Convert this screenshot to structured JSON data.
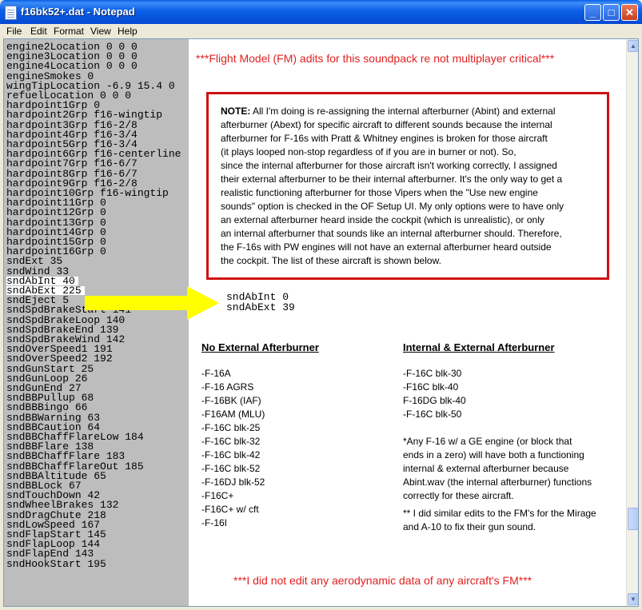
{
  "window": {
    "title": "f16bk52+.dat - Notepad"
  },
  "menu": [
    "File",
    "Edit",
    "Format",
    "View",
    "Help"
  ],
  "colors": {
    "header_red": "#E02020",
    "box_red": "#D01010",
    "arrow_yellow": "#FFFF00",
    "panel_gray": "#BDBDBD"
  },
  "text_lines": [
    "engine2Location 0 0 0",
    "engine3Location 0 0 0",
    "engine4Location 0 0 0",
    "engineSmokes 0",
    "wingTipLocation -6.9 15.4 0",
    "refuelLocation 0 0 0",
    "hardpoint1Grp 0",
    "hardpoint2Grp f16-wingtip",
    "hardpoint3Grp f16-2/8",
    "hardpoint4Grp f16-3/4",
    "hardpoint5Grp f16-3/4",
    "hardpoint6Grp f16-centerline",
    "hardpoint7Grp f16-6/7",
    "hardpoint8Grp f16-6/7",
    "hardpoint9Grp f16-2/8",
    "hardpoint10Grp f16-wingtip",
    "hardpoint11Grp 0",
    "hardpoint12Grp 0",
    "hardpoint13Grp 0",
    "hardpoint14Grp 0",
    "hardpoint15Grp 0",
    "hardpoint16Grp 0",
    "sndExt 35",
    "sndWind 33",
    "sndAbInt 40",
    "sndAbExt 225",
    "sndEject 5",
    "sndSpdBrakeStart 141",
    "sndSpdBrakeLoop 140",
    "sndSpdBrakeEnd 139",
    "sndSpdBrakeWind 142",
    "sndOverSpeed1 191",
    "sndOverSpeed2 192",
    "sndGunStart 25",
    "sndGunLoop 26",
    "sndGunEnd 27",
    "sndBBPullup 68",
    "sndBBBingo 66",
    "sndBBWarning 63",
    "sndBBCaution 64",
    "sndBBChaffFlareLow 184",
    "sndBBFlare 138",
    "sndBBChaffFlare 183",
    "sndBBChaffFlareOut 185",
    "sndBBAltitude 65",
    "sndBBLock 67",
    "sndTouchDown 42",
    "sndWheelBrakes 132",
    "sndDragChute 218",
    "sndLowSpeed 167",
    "sndFlapStart 145",
    "sndFlapLoop 144",
    "sndFlapEnd 143",
    "sndHookStart 195"
  ],
  "header_note": "***Flight Model (FM) adits for this soundpack re not multiplayer  critical***",
  "note": {
    "label": "NOTE:",
    "lines": [
      " All I'm doing is re-assigning the internal afterburner (Abint) and external",
      "afterburner (Abext) for specific aircraft to different sounds because the internal",
      "afterburner for F-16s with Pratt & Whitney engines is broken for those aircraft",
      "(it plays looped non-stop regardless of if you are in burner or not). So,",
      "since the internal afterburner for those aircraft isn't working correctly, I assigned",
      "their external afterburner to be their internal afterburner.  It's the only way to get a",
      "realistic functioning afterburner for those Vipers when the \"Use new engine",
      "sounds\" option is checked in the OF Setup UI.  My only options were to have only",
      "an external afterburner heard inside the cockpit (which is unrealistic), or only",
      "an internal afterburner that sounds like an internal afterburner should.  Therefore,",
      "the F-16s with PW engines will not have an external afterburner heard outside",
      "the cockpit.  The list of these aircraft is shown below."
    ]
  },
  "new_values": [
    "sndAbInt 0",
    "sndAbExt 39"
  ],
  "no_external": {
    "heading": "No External Afterburner",
    "items": [
      "-F-16A",
      "-F-16 AGRS",
      "-F-16BK (IAF)",
      "-F16AM (MLU)",
      "-F-16C blk-25",
      "-F-16C blk-32",
      "-F-16C blk-42",
      "-F-16C blk-52",
      "-F-16DJ blk-52",
      "-F16C+",
      "-F16C+ w/ cft",
      "-F-16I"
    ]
  },
  "int_ext": {
    "heading": "Internal & External Afterburner",
    "items": [
      "-F-16C blk-30",
      "-F16C blk-40",
      "F-16DG blk-40",
      "-F-16C blk-50"
    ]
  },
  "ge_note": [
    "*Any F-16 w/ a GE engine (or block that",
    "ends in a zero) will have both a functioning",
    "internal & external afterburner because",
    "Abint.wav (the internal afterburner) functions",
    "correctly for these aircraft."
  ],
  "similar_note": [
    "** I did similar edits to the FM's for the Mirage",
    "and A-10 to fix their gun sound."
  ],
  "footer_note": "***I did not edit any aerodynamic data of any aircraft's FM***"
}
